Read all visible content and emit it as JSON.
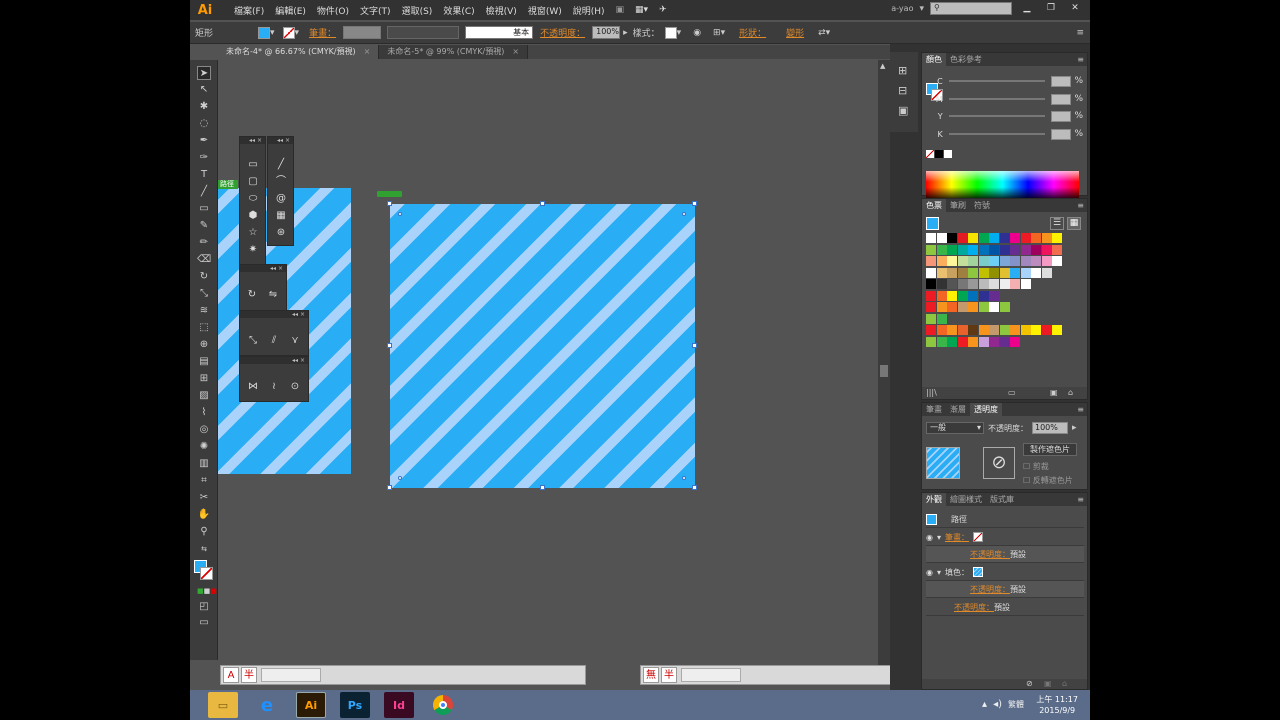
{
  "app": {
    "logo": "Ai",
    "menu": [
      "檔案(F)",
      "編輯(E)",
      "物件(O)",
      "文字(T)",
      "選取(S)",
      "效果(C)",
      "檢視(V)",
      "視窗(W)",
      "說明(H)"
    ],
    "user": "a-yao"
  },
  "controlbar": {
    "shape_label": "矩形",
    "stroke_label": "筆畫：",
    "stroke_profile": "基本",
    "opacity_label": "不透明度：",
    "opacity_value": "100%",
    "style_label": "樣式：",
    "shape_link": "形狀：",
    "transform_link": "變形"
  },
  "tabs": [
    {
      "label": "未命名-4* @ 66.67% (CMYK/預視)",
      "active": true
    },
    {
      "label": "未命名-5* @ 99% (CMYK/預視)",
      "active": false
    }
  ],
  "canvas": {
    "path_tag": "路徑"
  },
  "color_panel": {
    "tabs": [
      "顏色",
      "色彩參考"
    ],
    "channels": [
      "C",
      "M",
      "Y",
      "K"
    ],
    "pct": "%"
  },
  "swatches_panel": {
    "tabs": [
      "色票",
      "筆刷",
      "符號"
    ]
  },
  "transparency_panel": {
    "tabs": [
      "筆畫",
      "漸層",
      "透明度"
    ],
    "blend_mode": "一般",
    "opacity_label": "不透明度：",
    "opacity_value": "100%",
    "make_mask": "製作遮色片",
    "clip": "剪裁",
    "invert_mask": "反轉遮色片"
  },
  "appearance_panel": {
    "tabs": [
      "外觀",
      "繪圖樣式",
      "版式庫"
    ],
    "object": "路徑",
    "stroke_label": "筆畫：",
    "opacity_link": "不透明度：",
    "opacity_default": "預設",
    "fill_label": "填色："
  },
  "status": {
    "ime_left": [
      "A",
      "半"
    ],
    "ime_right": [
      "無",
      "半"
    ]
  },
  "taskbar": {
    "apps": [
      "Explorer",
      "IE",
      "Ai",
      "Ps",
      "Id",
      "Chrome"
    ],
    "tray_lang": "繁體",
    "time": "上午 11:17",
    "date": "2015/9/9"
  },
  "colors": {
    "fill_blue": "#29aef5",
    "stripe": "#a9d3fa",
    "accent_orange": "#e08a2a"
  }
}
